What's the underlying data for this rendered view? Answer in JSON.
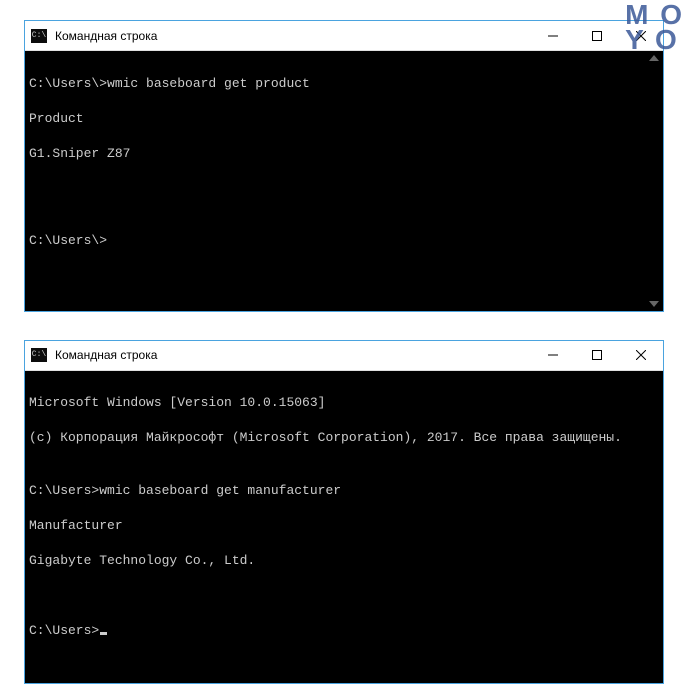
{
  "watermark": {
    "line1": "M O",
    "line2": "Y O"
  },
  "windows": [
    {
      "title": "Командная строка",
      "body": {
        "line0": "C:\\Users\\>wmic baseboard get product",
        "line1": "Product",
        "line2": "G1.Sniper Z87",
        "blank": "",
        "prompt": "C:\\Users\\>"
      }
    },
    {
      "title": "Командная строка",
      "body": {
        "line0": "Microsoft Windows [Version 10.0.15063]",
        "line1": "(c) Корпорация Майкрософт (Microsoft Corporation), 2017. Все права защищены.",
        "blank0": "",
        "line2": "C:\\Users>wmic baseboard get manufacturer",
        "line3": "Manufacturer",
        "line4": "Gigabyte Technology Co., Ltd.",
        "blank1": "",
        "blank2": "",
        "prompt": "C:\\Users>"
      }
    }
  ]
}
